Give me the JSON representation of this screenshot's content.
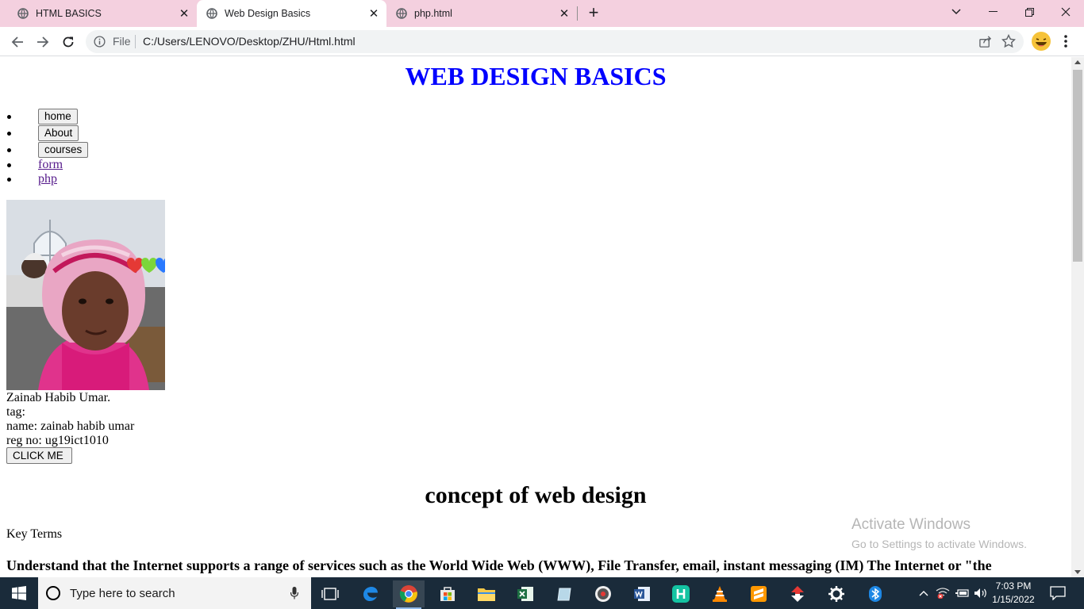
{
  "browser": {
    "tabs": [
      {
        "label": "HTML BASICS",
        "active": false
      },
      {
        "label": "Web Design Basics",
        "active": true
      },
      {
        "label": "php.html",
        "active": false
      }
    ],
    "omnibox": {
      "security_label": "File",
      "url": "C:/Users/LENOVO/Desktop/ZHU/Html.html"
    }
  },
  "page": {
    "title": "WEB DESIGN BASICS",
    "nav_buttons": [
      "home",
      "About",
      "courses"
    ],
    "nav_links": [
      "form",
      "php"
    ],
    "photo_caption": "Zainab Habib Umar.",
    "tag_line": "tag:",
    "name_line": "name: zainab habib umar",
    "reg_line": "reg no: ug19ict1010",
    "click_button": "CLICK ME",
    "section_title": "concept of web design",
    "key_terms": "Key Terms",
    "paragraph": "Understand that the Internet supports a range of services such as the World Wide Web (WWW), File Transfer, email, instant messaging (IM) The Internet or \"the"
  },
  "watermark": {
    "line1": "Activate Windows",
    "line2": "Go to Settings to activate Windows."
  },
  "taskbar": {
    "search_placeholder": "Type here to search",
    "time": "7:03 PM",
    "date": "1/15/2022"
  },
  "colors": {
    "tabstrip": "#f4d0df",
    "title_blue": "#0000ff",
    "visited_link": "#551a8b",
    "taskbar": "#1a2b3a"
  }
}
